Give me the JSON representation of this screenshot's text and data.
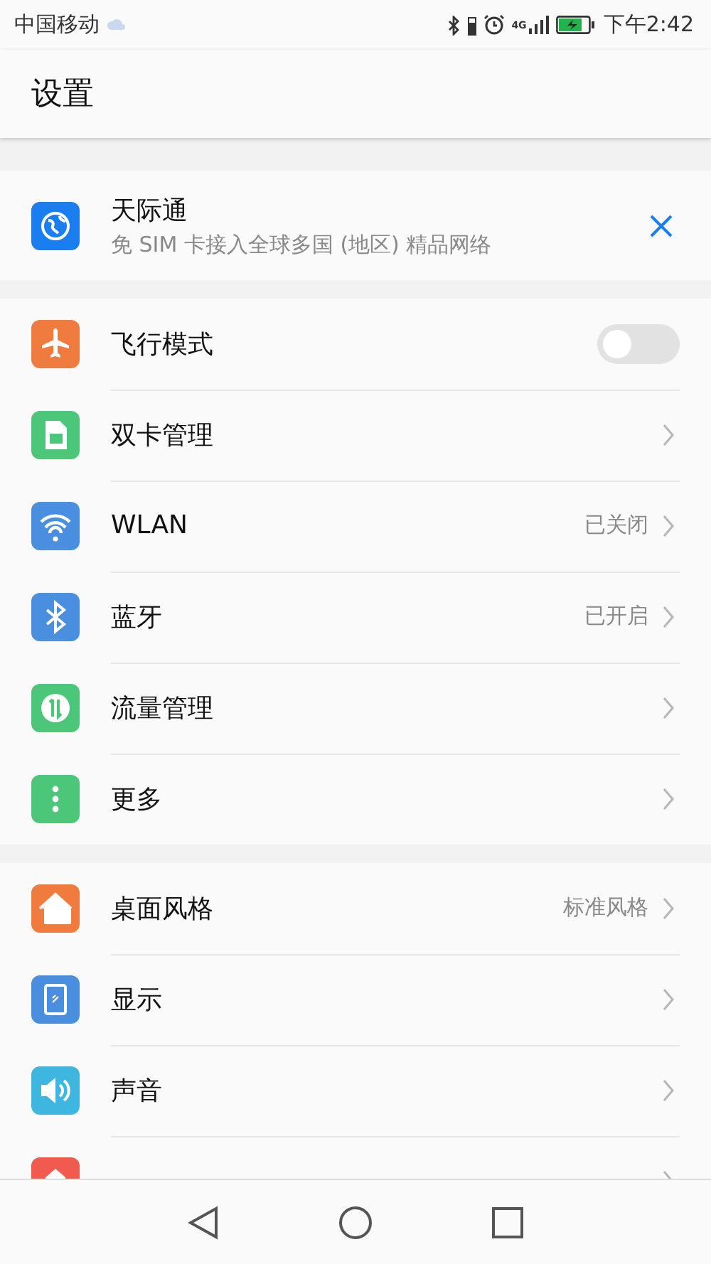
{
  "status_bar": {
    "carrier": "中国移动",
    "network_type": "4G",
    "time": "下午2:42"
  },
  "header": {
    "title": "设置"
  },
  "suggestions": {
    "card": {
      "title": "天际通",
      "subtitle": "免 SIM 卡接入全球多国 (地区) 精品网络"
    }
  },
  "groups": [
    {
      "items": [
        {
          "kind": "toggle",
          "label": "飞行模式",
          "on": false
        },
        {
          "kind": "link",
          "label": "双卡管理"
        },
        {
          "kind": "link",
          "label": "WLAN",
          "value": "已关闭"
        },
        {
          "kind": "link",
          "label": "蓝牙",
          "value": "已开启"
        },
        {
          "kind": "link",
          "label": "流量管理"
        },
        {
          "kind": "link",
          "label": "更多"
        }
      ]
    },
    {
      "items": [
        {
          "kind": "link",
          "label": "桌面风格",
          "value": "标准风格"
        },
        {
          "kind": "link",
          "label": "显示"
        },
        {
          "kind": "link",
          "label": "声音"
        },
        {
          "kind": "link"
        }
      ]
    }
  ]
}
